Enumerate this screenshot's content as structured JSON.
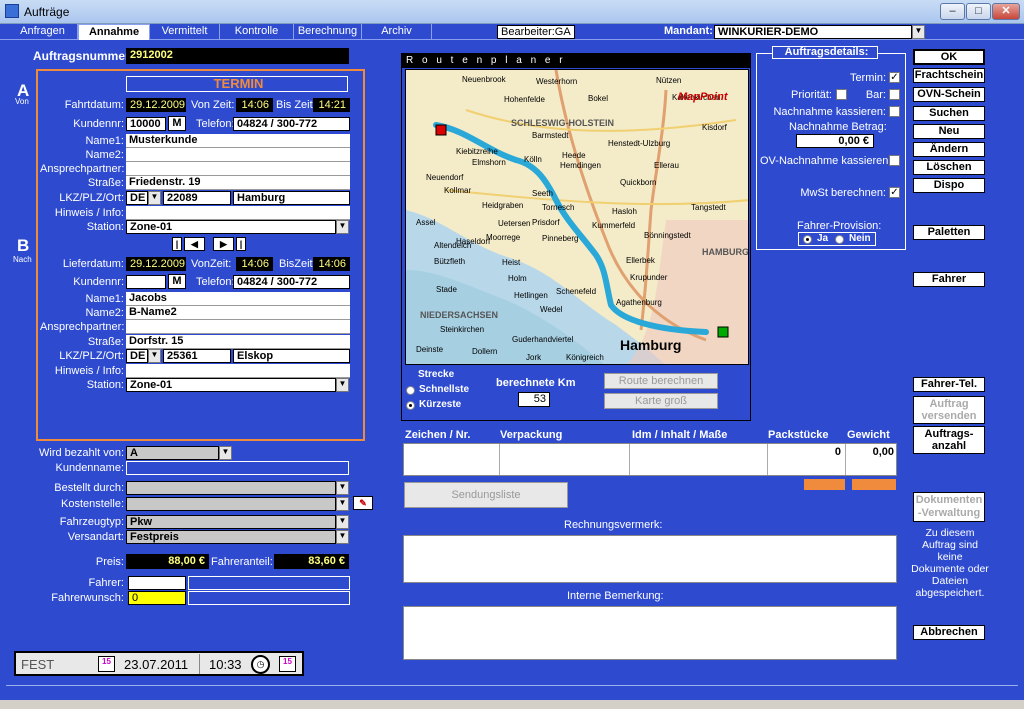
{
  "window": {
    "title": "Aufträge",
    "minimize": "‒",
    "maximize": "□",
    "close": "✕"
  },
  "tabs": [
    "Anfragen",
    "Annahme",
    "Vermittelt",
    "Kontrolle",
    "Berechnung",
    "Archiv"
  ],
  "header": {
    "bearbeiter": "Bearbeiter:GA",
    "mandant_label": "Mandant:",
    "mandant_value": "WINKURIER-DEMO",
    "auftragsnummer_label": "Auftragsnummer:",
    "auftragsnummer_value": "2912002"
  },
  "termin": {
    "title": "TERMIN",
    "badge_a": "A",
    "badge_a_sub": "Von",
    "badge_b": "B",
    "badge_b_sub": "Nach",
    "fahrdatum_label": "Fahrtdatum:",
    "fahrdatum": "29.12.2009",
    "vonzeit_label": "Von Zeit:",
    "vonzeit": "14:06",
    "biszeit_label": "Bis Zeit:",
    "biszeit": "14:21",
    "kundennr_label": "Kundennr:",
    "kundennr": "10000",
    "m_label": "M",
    "telefon_label": "Telefon:",
    "telefon": "04824 / 300-772",
    "name1_label": "Name1:",
    "name1": "Musterkunde",
    "name2_label": "Name2:",
    "name2": "",
    "ansprech_label": "Ansprechpartner:",
    "ansprech": "",
    "strasse_label": "Straße:",
    "strasse": "Friedenstr. 19",
    "lkz_label": "LKZ/PLZ/Ort:",
    "lkz": "DE",
    "plz": "22089",
    "ort": "Hamburg",
    "hinweis_label": "Hinweis / Info:",
    "hinweis": "",
    "station_label": "Station:",
    "station": "Zone-01"
  },
  "nav_icons": [
    "first-icon",
    "prev-icon",
    "next-icon",
    "last-icon"
  ],
  "lieferung": {
    "lieferdatum_label": "Lieferdatum:",
    "lieferdatum": "29.12.2009",
    "vonzeit_label": "VonZeit:",
    "vonzeit": "14:06",
    "biszeit_label": "BisZeit:",
    "biszeit": "14:06",
    "kundennr_label": "Kundennr:",
    "kundennr": "",
    "m_label": "M",
    "telefon_label": "Telefon:",
    "telefon": "04824 / 300-772",
    "name1_label": "Name1:",
    "name1": "Jacobs",
    "name2_label": "Name2:",
    "name2": "B-Name2",
    "ansprech_label": "Ansprechpartner:",
    "ansprech": "",
    "strasse_label": "Straße:",
    "strasse": "Dorfstr. 15",
    "lkz_label": "LKZ/PLZ/Ort:",
    "lkz": "DE",
    "plz": "25361",
    "ort": "Elskop",
    "hinweis_label": "Hinweis / Info:",
    "hinweis": "",
    "station_label": "Station:",
    "station": "Zone-01"
  },
  "billing": {
    "bezahlt_label": "Wird bezahlt von:",
    "bezahlt": "A",
    "kundenname_label": "Kundenname:",
    "kundenname": "",
    "bestellt_label": "Bestellt durch:",
    "bestellt": "",
    "kostenstelle_label": "Kostenstelle:",
    "kostenstelle": "",
    "fahrzeugtyp_label": "Fahrzeugtyp:",
    "fahrzeugtyp": "Pkw",
    "versandart_label": "Versandart:",
    "versandart": "Festpreis",
    "preis_label": "Preis:",
    "preis": "88,00 €",
    "fahreranteil_label": "Fahreranteil:",
    "fahreranteil": "83,60 €",
    "fahrer_label": "Fahrer:",
    "fahrer": "",
    "fahrerwunsch_label": "Fahrerwunsch:",
    "fahrerwunsch": "0"
  },
  "statusbar": {
    "mode": "FEST",
    "date": "23.07.2011",
    "time": "10:33"
  },
  "routenplaner": {
    "title": "R o u t e n p l a n e r",
    "strecke_label": "Strecke",
    "schnellste": "Schnellste",
    "kuerzeste": "Kürzeste",
    "km_label": "berechnete Km",
    "km": "53",
    "route_btn": "Route berechnen",
    "karte_btn": "Karte groß",
    "map": {
      "brand": "MapPoint",
      "cities": [
        "Neuenbrook",
        "Westerhorn",
        "Nützen",
        "Kaltenkirchen",
        "Hohenfelde",
        "Bokel",
        "Kisdorf",
        "Barmstedt",
        "SCHLESWIG-HOLSTEIN",
        "Henstedt-Ulzburg",
        "Kiebitzreihe",
        "Elmshorn",
        "Kölln",
        "Heede",
        "Hemdingen",
        "Ellerau",
        "Neuendorf",
        "Kollmar",
        "Seeth",
        "Quickborn",
        "Tangstedt",
        "Heidgraben",
        "Tornesch",
        "Hasloh",
        "Assel",
        "Uetersen",
        "Prisdorf",
        "Kummerfeld",
        "Haseldorf",
        "Moorrege",
        "Pinneberg",
        "Bönningstedt",
        "Altendeich",
        "Bützfleth",
        "Heist",
        "Ellerbek",
        "HAMBURG",
        "Hetlingen",
        "Holm",
        "Krupunder",
        "Stade",
        "Schenefeld",
        "Agathenburg",
        "Wedel",
        "Steinkirchen",
        "NIEDERSACHSEN",
        "Guderhandviertel",
        "Hamburg",
        "Deinste",
        "Dollern",
        "Jork",
        "Königreich"
      ]
    }
  },
  "auftragsdetails": {
    "title": "Auftragsdetails:",
    "termin_label": "Termin:",
    "termin_checked": "✓",
    "prioritaet_label": "Priorität:",
    "bar_label": "Bar:",
    "nachnahme_label": "Nachnahme kassieren:",
    "nachnahme_betrag_label": "Nachnahme Betrag:",
    "nachnahme_betrag": "0,00 €",
    "ov_label": "OV-Nachnahme kassieren:",
    "mwst_label": "MwSt berechnen:",
    "mwst_checked": "✓",
    "provision_label": "Fahrer-Provision:",
    "ja": "Ja",
    "nein": "Nein"
  },
  "right_buttons": {
    "ok": "OK",
    "frachtschein": "Frachtschein",
    "ovn": "OVN-Schein",
    "suchen": "Suchen",
    "neu": "Neu",
    "aendern": "Ändern",
    "loeschen": "Löschen",
    "dispo": "Dispo",
    "paletten": "Paletten",
    "fahrer": "Fahrer",
    "fahrer_tel": "Fahrer-Tel.",
    "auftrag_versenden_1": "Auftrag",
    "auftrag_versenden_2": "versenden",
    "auftragsanzahl_1": "Auftrags-",
    "auftragsanzahl_2": "anzahl",
    "dokumente_1": "Dokumenten",
    "dokumente_2": "-Verwaltung",
    "doc_info": "Zu diesem Auftrag sind keine Dokumente oder Dateien abgespeichert.",
    "abbrechen": "Abbrechen"
  },
  "goods": {
    "headers": [
      "Zeichen / Nr.",
      "Verpackung",
      "Idm / Inhalt / Maße",
      "Packstücke",
      "Gewicht"
    ],
    "packstuecke": "0",
    "gewicht": "0,00",
    "sendungsliste": "Sendungsliste",
    "rechnungsvermerk_label": "Rechnungsvermerk:",
    "interne_label": "Interne Bemerkung:"
  }
}
